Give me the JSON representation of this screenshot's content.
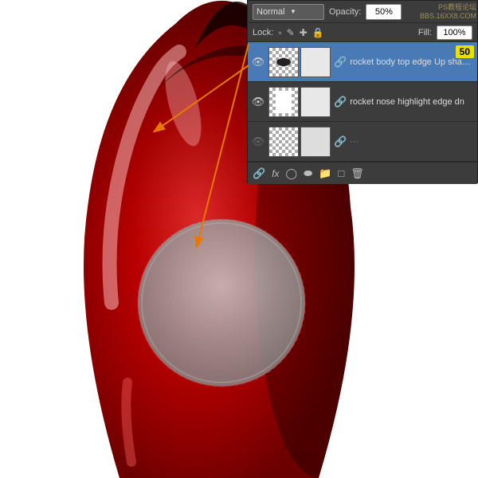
{
  "panel": {
    "blend_mode": "Normal",
    "opacity_label": "Opacity:",
    "opacity_value": "50%",
    "lock_label": "Lock:",
    "fill_label": "Fill:",
    "fill_value": "100%",
    "opacity_badge": "50",
    "layers": [
      {
        "id": "layer1",
        "name": "rocket body top edge Up shadow",
        "visible": true,
        "selected": true,
        "has_badge": true,
        "thumb_type": "oval"
      },
      {
        "id": "layer2",
        "name": "rocket nose highlight edge dn",
        "visible": true,
        "selected": false,
        "has_badge": false,
        "thumb_type": "white"
      },
      {
        "id": "layer3",
        "name": "...",
        "visible": false,
        "selected": false,
        "has_badge": false,
        "thumb_type": "white2"
      }
    ],
    "bottom_icons": [
      "link",
      "fx",
      "adjustment",
      "circle",
      "folder",
      "trash-note",
      "trash"
    ]
  },
  "watermark": {
    "line1": "PS教程论坛",
    "line2": "BBS.16XX8.COM"
  }
}
